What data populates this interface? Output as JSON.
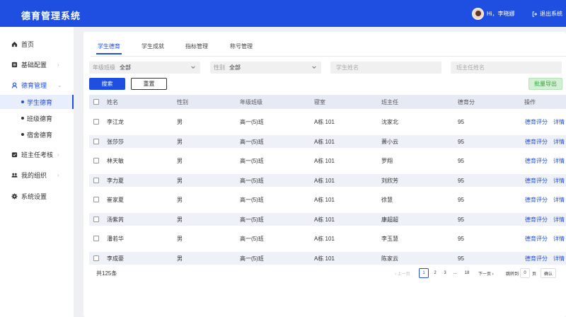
{
  "app": {
    "title": "德育管理系统",
    "greeting": "Hi，李晓娜",
    "logout": "退出系统"
  },
  "sidebar": {
    "items": [
      {
        "label": "首页",
        "icon": "home-icon"
      },
      {
        "label": "基础配置",
        "icon": "list-icon"
      },
      {
        "label": "德育管理",
        "icon": "moral-icon"
      },
      {
        "label": "班主任考核",
        "icon": "assessment-icon"
      },
      {
        "label": "我的组织",
        "icon": "organization-icon"
      },
      {
        "label": "系统设置",
        "icon": "gear-icon"
      }
    ],
    "sub_items": [
      {
        "label": "学生德育",
        "active": true
      },
      {
        "label": "班级德育",
        "active": false
      },
      {
        "label": "宿舍德育",
        "active": false
      }
    ]
  },
  "tabs": [
    "学生德育",
    "学生成就",
    "指标管理",
    "称号管理"
  ],
  "filters": {
    "grade_label": "年级班级",
    "grade_value": "全部",
    "gender_label": "性别",
    "gender_value": "全部",
    "student_placeholder": "学生姓名",
    "teacher_placeholder": "班主任姓名"
  },
  "buttons": {
    "search": "搜索",
    "reset": "重置",
    "export": "批量导出"
  },
  "table": {
    "headers": {
      "name": "姓名",
      "gender": "性别",
      "class": "年级班级",
      "dorm": "寝室",
      "teacher": "班主任",
      "score": "德育分",
      "ops": "操作"
    },
    "rows": [
      {
        "name": "李江龙",
        "gender": "男",
        "class": "高一(5)班",
        "dorm": "A栋 101",
        "teacher": "沈家北",
        "score": "95"
      },
      {
        "name": "张莎莎",
        "gender": "男",
        "class": "高一(5)班",
        "dorm": "A栋 101",
        "teacher": "萧小云",
        "score": "95"
      },
      {
        "name": "林天敏",
        "gender": "男",
        "class": "高一(5)班",
        "dorm": "A栋 101",
        "teacher": "罗翔",
        "score": "95"
      },
      {
        "name": "李力夏",
        "gender": "男",
        "class": "高一(5)班",
        "dorm": "A栋 101",
        "teacher": "刘欣芳",
        "score": "95"
      },
      {
        "name": "崔家夏",
        "gender": "男",
        "class": "高一(5)班",
        "dorm": "A栋 101",
        "teacher": "徐慧",
        "score": "95"
      },
      {
        "name": "汤紫芮",
        "gender": "男",
        "class": "高一(5)班",
        "dorm": "A栋 101",
        "teacher": "康超超",
        "score": "95"
      },
      {
        "name": "潘若华",
        "gender": "男",
        "class": "高一(5)班",
        "dorm": "A栋 101",
        "teacher": "李玉慧",
        "score": "95"
      },
      {
        "name": "李成豪",
        "gender": "男",
        "class": "高一(5)班",
        "dorm": "A栋 101",
        "teacher": "陈家云",
        "score": "95"
      }
    ],
    "op_score": "德育评分",
    "op_detail": "详情"
  },
  "pagination": {
    "total": "共125条",
    "prev": "‹ 上一页",
    "pages": [
      "1",
      "2",
      "3",
      "...",
      "18"
    ],
    "next": "下一页 ›",
    "jump": "跳转到",
    "jump_value": "0",
    "unit": "页",
    "go": "确认"
  }
}
